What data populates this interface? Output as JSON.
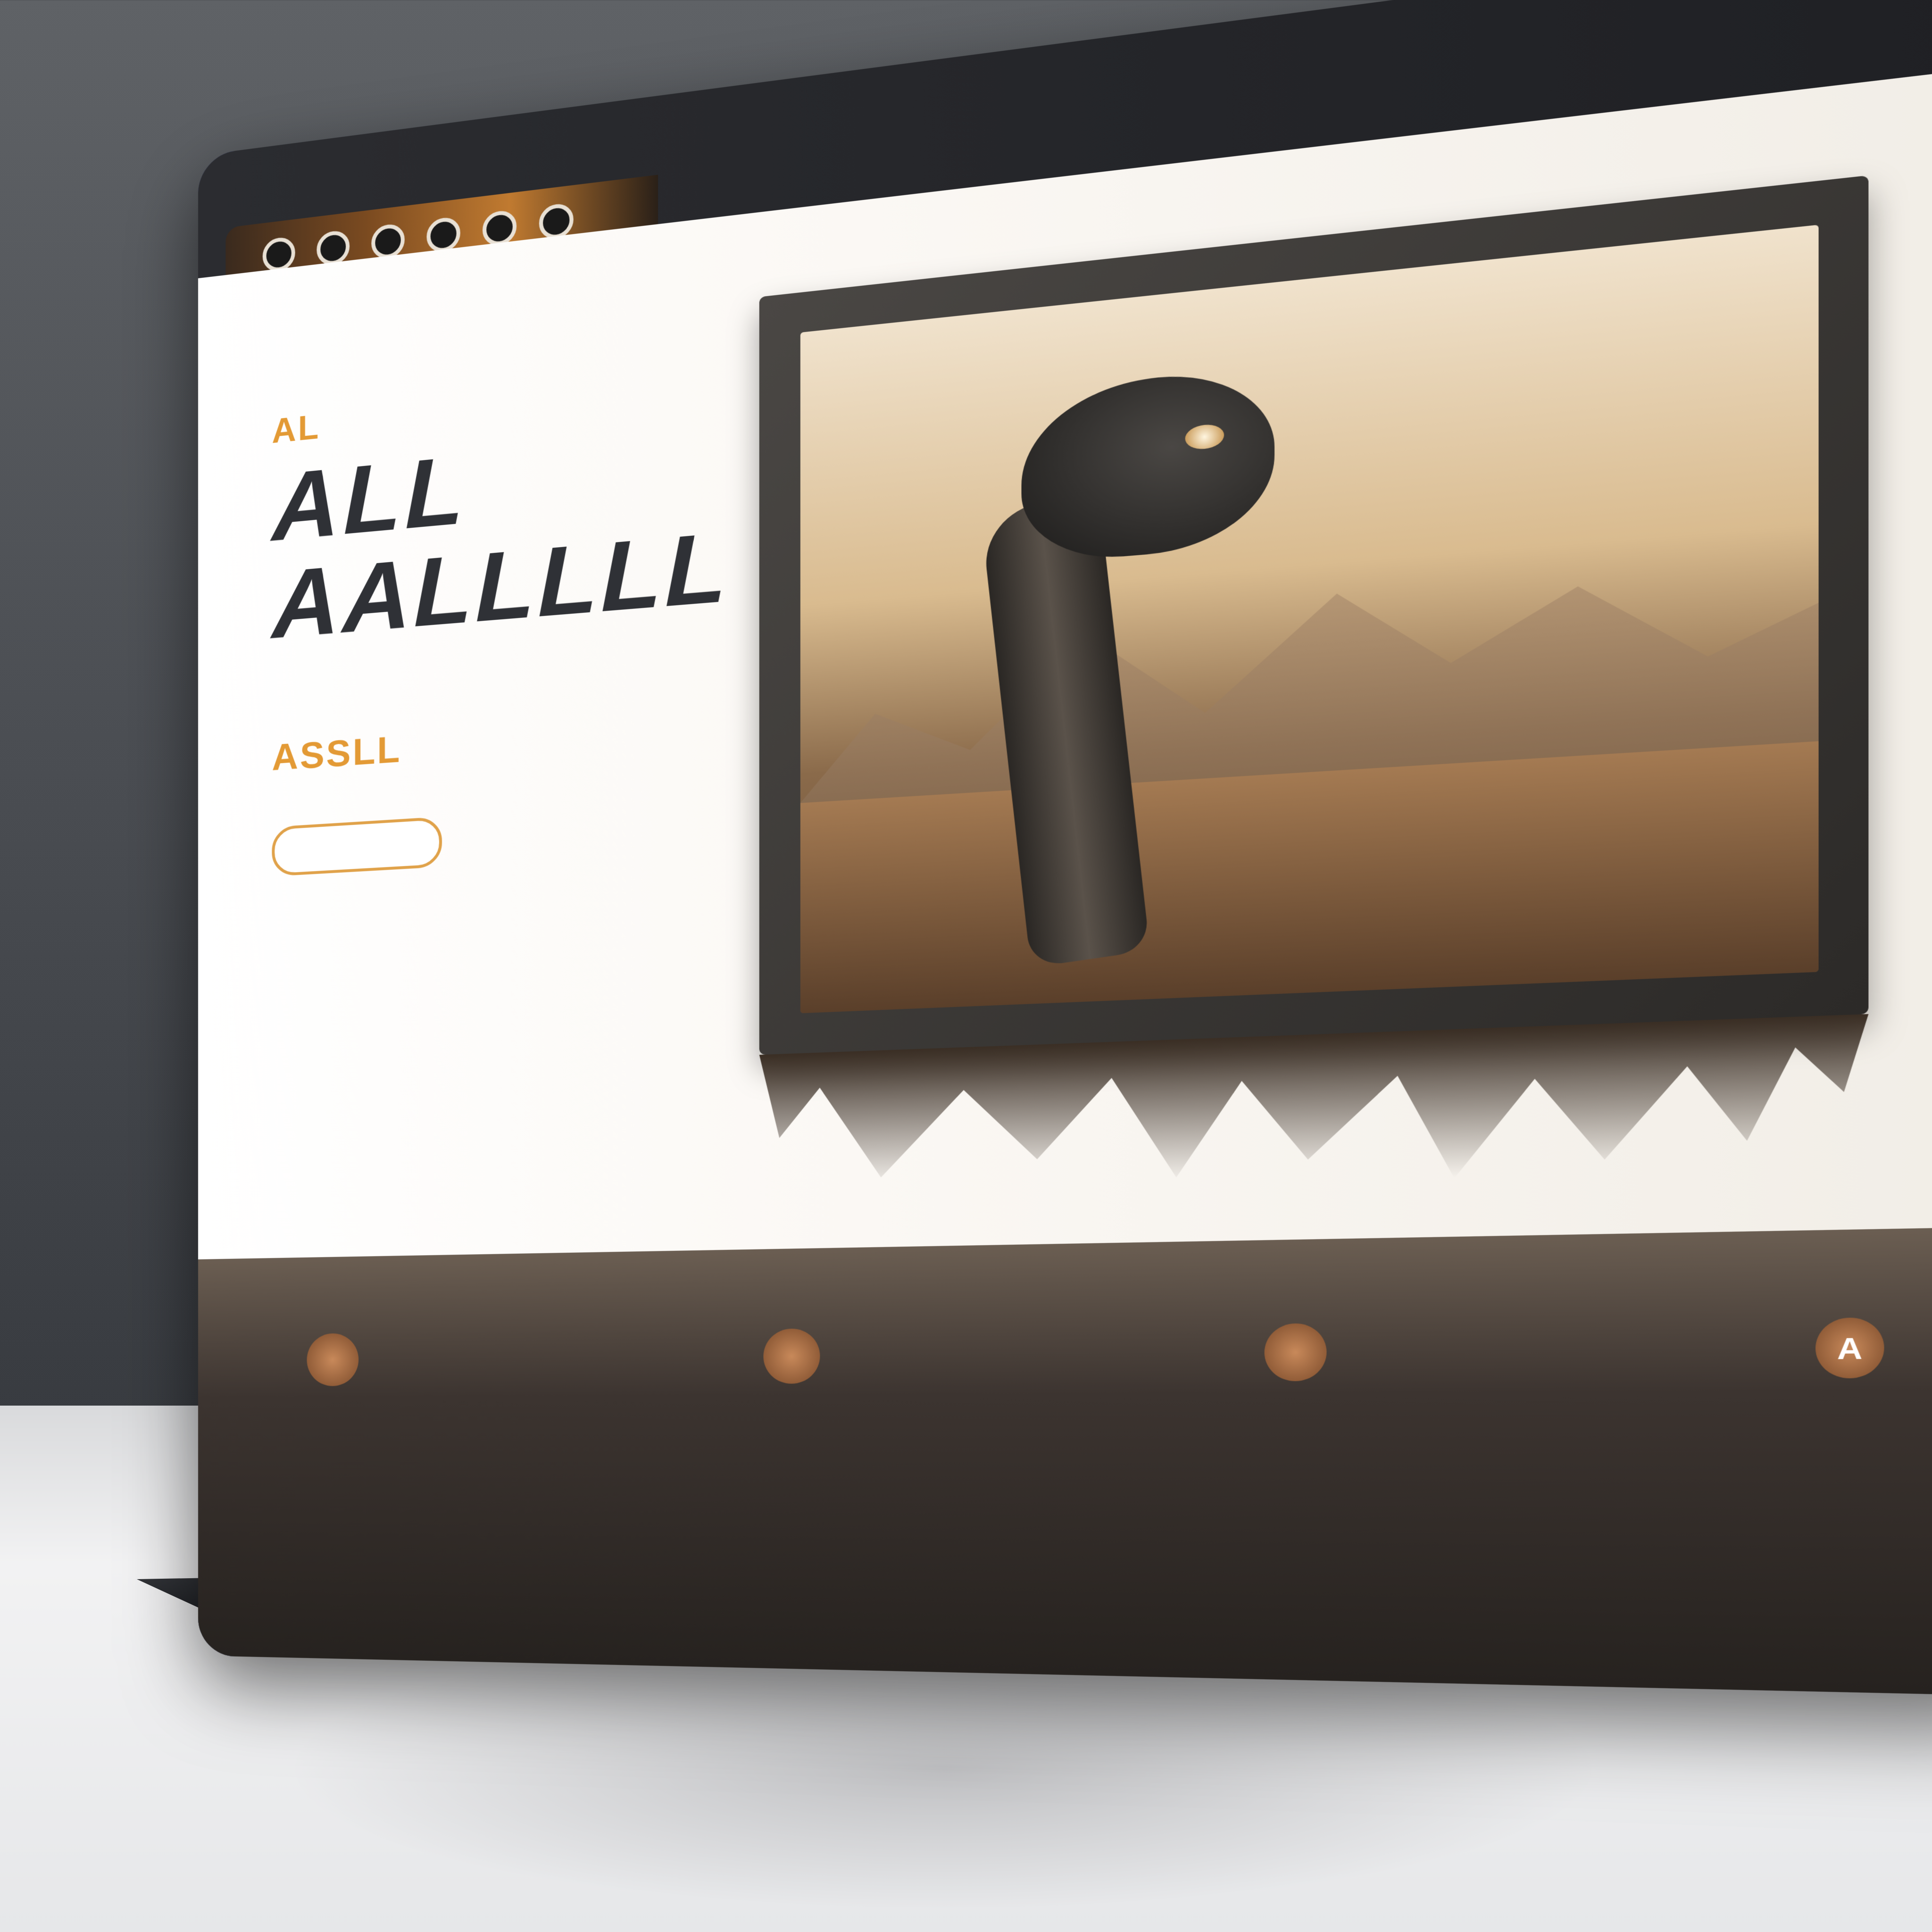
{
  "nav": [
    "",
    "",
    "",
    "",
    "",
    "",
    ""
  ],
  "hero": {
    "eyebrow": "AL",
    "title_line1": "ALL",
    "title_line2": "AALLLLL",
    "subheading": "ASSLL",
    "description": "",
    "meta": "",
    "cta_label": ""
  },
  "footer": {
    "stats": [
      {
        "icon": "",
        "label": "",
        "text": ""
      },
      {
        "icon": "",
        "label": "",
        "text": ""
      },
      {
        "icon": "",
        "label": "",
        "text": ""
      },
      {
        "icon": "A",
        "label": "",
        "text": ""
      }
    ]
  },
  "colors": {
    "accent": "#e39a35",
    "dark": "#2f3136",
    "frame": "#2c2a28",
    "footer": "#26221f"
  },
  "icons": [
    "thumb-icon",
    "stat-icon",
    "keyboard",
    "frame-image"
  ]
}
